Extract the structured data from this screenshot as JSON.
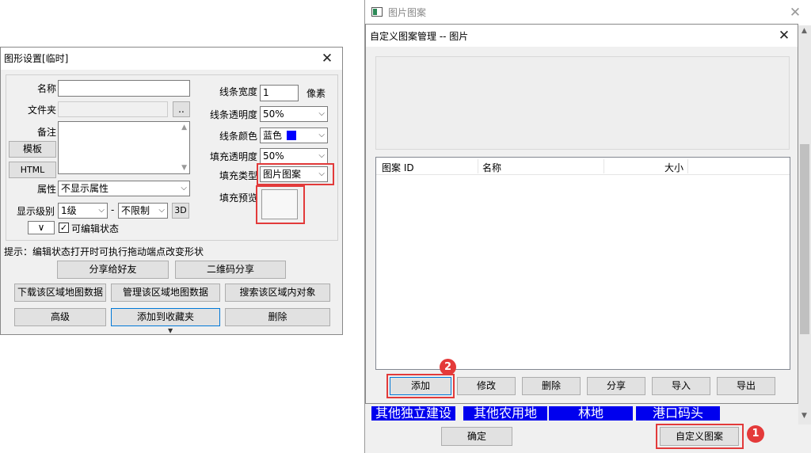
{
  "left_dialog": {
    "title": "图形设置[临时]",
    "name_label": "名称",
    "name_value": "",
    "folder_label": "文件夹",
    "folder_browse": "..",
    "note_label": "备注",
    "template_button": "模板",
    "html_button": "HTML",
    "attr_label": "属性",
    "attr_value": "不显示属性",
    "level_label": "显示级别",
    "level_from": "1级",
    "level_dash": "-",
    "level_to": "不限制",
    "btn_3d": "3D",
    "editable_label": "可编辑状态",
    "line_width_label": "线条宽度",
    "line_width_value": "1",
    "line_width_unit": "像素",
    "line_alpha_label": "线条透明度",
    "line_alpha_value": "50%",
    "line_color_label": "线条颜色",
    "line_color_value": "蓝色",
    "line_color_hex": "#0000ff",
    "fill_alpha_label": "填充透明度",
    "fill_alpha_value": "50%",
    "fill_type_label": "填充类型",
    "fill_type_value": "图片图案",
    "fill_preview_label": "填充预览",
    "hint": "提示：编辑状态打开时可执行拖动端点改变形状",
    "share_friend": "分享给好友",
    "qr_share": "二维码分享",
    "download_map": "下载该区域地图数据",
    "manage_map": "管理该区域地图数据",
    "search_area": "搜索该区域内对象",
    "advanced": "高级",
    "add_favorite": "添加到收藏夹",
    "delete": "删除"
  },
  "back_window": {
    "title": "图片图案",
    "cells": [
      "其他独立建设",
      "其他农用地",
      "林地",
      "港口码头"
    ],
    "ok_button": "确定",
    "custom_pattern_button": "自定义图案",
    "badge1": "1"
  },
  "pattern_dialog": {
    "title": "自定义图案管理 -- 图片",
    "columns": [
      "图案 ID",
      "名称",
      "",
      "大小"
    ],
    "add": "添加",
    "edit": "修改",
    "delete": "删除",
    "share": "分享",
    "import": "导入",
    "export": "导出",
    "badge2": "2"
  },
  "colors": {
    "highlight": "#e23a3a",
    "cell_blue": "#0000ee"
  }
}
